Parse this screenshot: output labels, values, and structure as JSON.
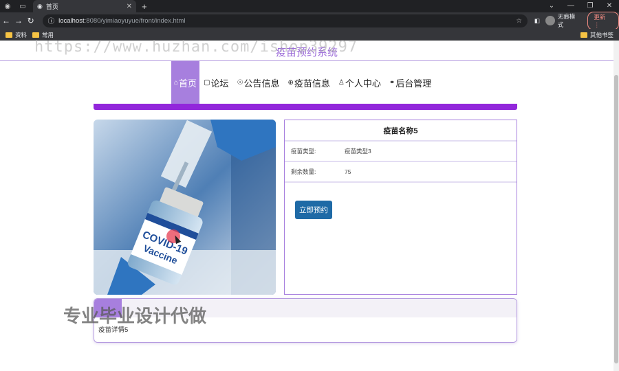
{
  "browser": {
    "tab_title": "首页",
    "url_host": "localhost",
    "url_path": ":8080/yimiaoyuyue/front/index.html",
    "profile_label": "无痕模式",
    "update_label": "更新",
    "bookmarks": [
      "资料",
      "常用"
    ],
    "other_bookmarks": "其他书签"
  },
  "site": {
    "title": "疫苗预约系统",
    "nav": [
      {
        "icon": "⌂",
        "label": "首页"
      },
      {
        "icon": "▢",
        "label": "论坛"
      },
      {
        "icon": "☉",
        "label": "公告信息"
      },
      {
        "icon": "⊕",
        "label": "疫苗信息"
      },
      {
        "icon": "♙",
        "label": "个人中心"
      },
      {
        "icon": "⚭",
        "label": "后台管理"
      }
    ]
  },
  "product": {
    "name": "疫苗名称5",
    "type_label": "疫苗类型:",
    "type_value": "疫苗类型3",
    "remain_label": "剩余数量:",
    "remain_value": "75",
    "book_button": "立即预约",
    "image_text_line1": "COVID-19",
    "image_text_line2": "Vaccine"
  },
  "detail": {
    "text": "疫苗详情5"
  },
  "watermarks": {
    "url": "https://www.huzhan.com/ishop39297",
    "ad": "专业毕业设计代做"
  }
}
